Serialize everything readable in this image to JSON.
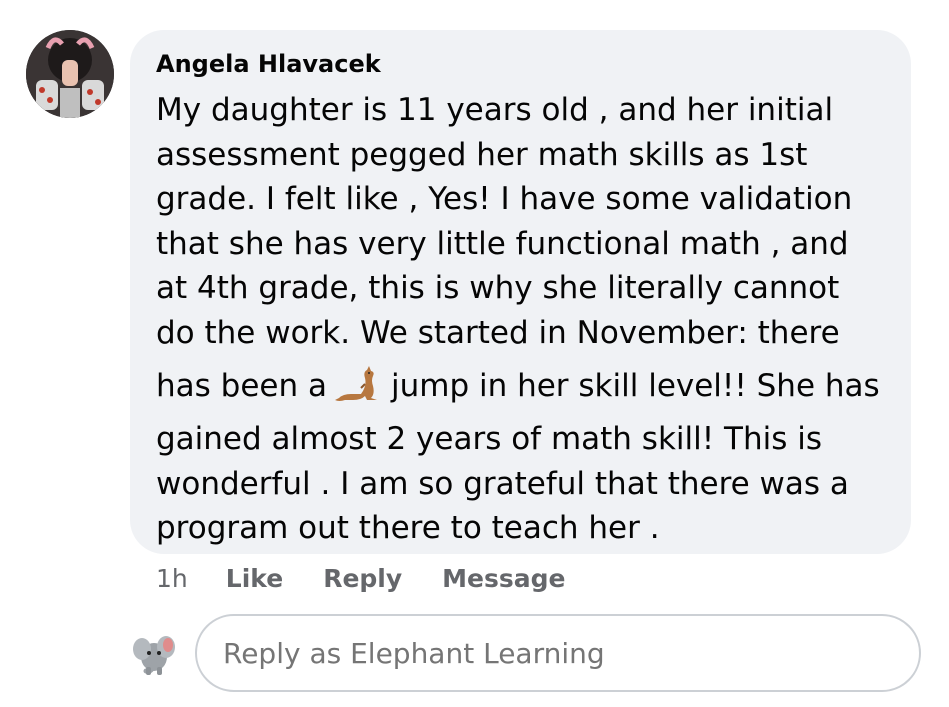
{
  "comment": {
    "author": "Angela Hlavacek",
    "lines": [
      "My daughter is 11 years old , and her initial",
      "assessment pegged her math skills as 1st",
      "grade. I felt like , Yes! I have some validation",
      "that she has very little functional math , and",
      "at 4th grade, this is why she literally cannot",
      "do the work. We started in November: there"
    ],
    "emoji_line_before": "has been a",
    "emoji_line_after": "jump in her skill level!! She has",
    "emoji_icon": "kangaroo-icon",
    "lines_after": [
      "gained almost 2 years of math skill! This is",
      "wonderful . I am so grateful that there was a",
      "program out there to teach her ."
    ]
  },
  "actions": {
    "time": "1h",
    "like": "Like",
    "reply": "Reply",
    "message": "Message"
  },
  "reply_box": {
    "placeholder": "Reply as Elephant Learning",
    "avatar_icon": "elephant-icon"
  },
  "colors": {
    "bubble": "#f0f2f5",
    "text": "#050505",
    "secondary": "#65676b",
    "input_border": "#ccd0d5"
  }
}
